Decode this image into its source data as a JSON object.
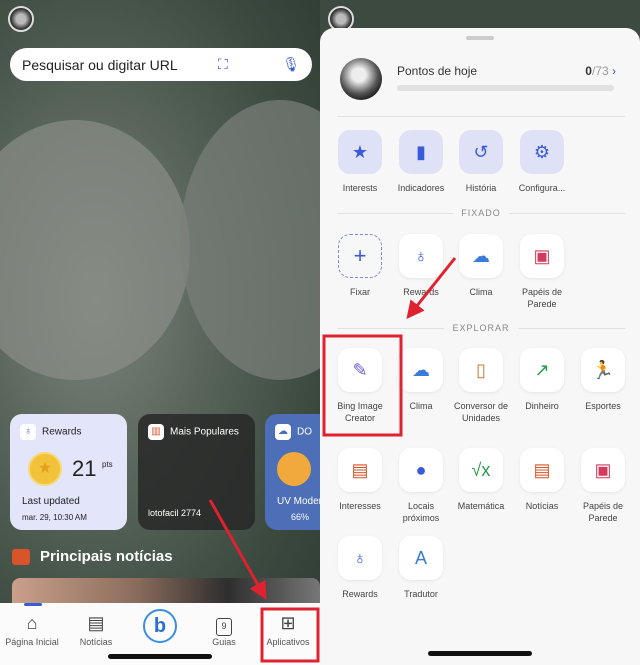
{
  "left": {
    "search_placeholder": "Pesquisar ou digitar URL",
    "cards": {
      "rewards": {
        "title": "Rewards",
        "points": "21",
        "unit": "pts",
        "updated_label": "Last updated",
        "updated_time": "mar. 29, 10:30 AM"
      },
      "popular": {
        "title": "Mais Populares",
        "item": "lotofacil 2774"
      },
      "weather": {
        "title": "DO",
        "condition": "UV Moder",
        "humidity": "66%"
      }
    },
    "news_heading": "Principais notícias",
    "nav": [
      {
        "label": "Página Inicial",
        "icon": "home-icon"
      },
      {
        "label": "Notícias",
        "icon": "news-icon"
      },
      {
        "label": "",
        "icon": "bing-chat-icon"
      },
      {
        "label": "Guias",
        "icon": "tabs-icon",
        "count": "9"
      },
      {
        "label": "Aplicativos",
        "icon": "apps-icon"
      }
    ]
  },
  "right": {
    "points_title": "Pontos de hoje",
    "points_current": "0",
    "points_total": "/73",
    "points_progress": 0,
    "quick": [
      {
        "label": "Interests",
        "icon": "star-plus-icon"
      },
      {
        "label": "Indicadores",
        "icon": "bookmark-icon"
      },
      {
        "label": "História",
        "icon": "history-icon"
      },
      {
        "label": "Configura...",
        "icon": "gear-icon"
      }
    ],
    "pinned_heading": "FIXADO",
    "pinned": [
      {
        "label": "Fixar",
        "icon": "plus-icon"
      },
      {
        "label": "Rewards",
        "icon": "medal-icon"
      },
      {
        "label": "Clima",
        "icon": "weather-icon"
      },
      {
        "label": "Papéis de Parede",
        "icon": "wallpaper-icon"
      }
    ],
    "explore_heading": "EXPLORAR",
    "explore": [
      {
        "label": "Bing Image Creator",
        "icon": "image-creator-icon"
      },
      {
        "label": "Clima",
        "icon": "weather-icon"
      },
      {
        "label": "Conversor de Unidades",
        "icon": "ruler-icon"
      },
      {
        "label": "Dinheiro",
        "icon": "chart-up-icon"
      },
      {
        "label": "Esportes",
        "icon": "runner-icon"
      },
      {
        "label": "Interesses",
        "icon": "news-icon"
      },
      {
        "label": "Locais próximos",
        "icon": "location-pin-icon"
      },
      {
        "label": "Matemática",
        "icon": "math-icon"
      },
      {
        "label": "Notícias",
        "icon": "news-icon"
      },
      {
        "label": "Papéis de Parede",
        "icon": "wallpaper-icon"
      },
      {
        "label": "Rewards",
        "icon": "medal-icon"
      },
      {
        "label": "Tradutor",
        "icon": "translate-icon"
      }
    ]
  },
  "colors": {
    "accent": "#3a5bd9",
    "annotation": "#e0212f"
  }
}
